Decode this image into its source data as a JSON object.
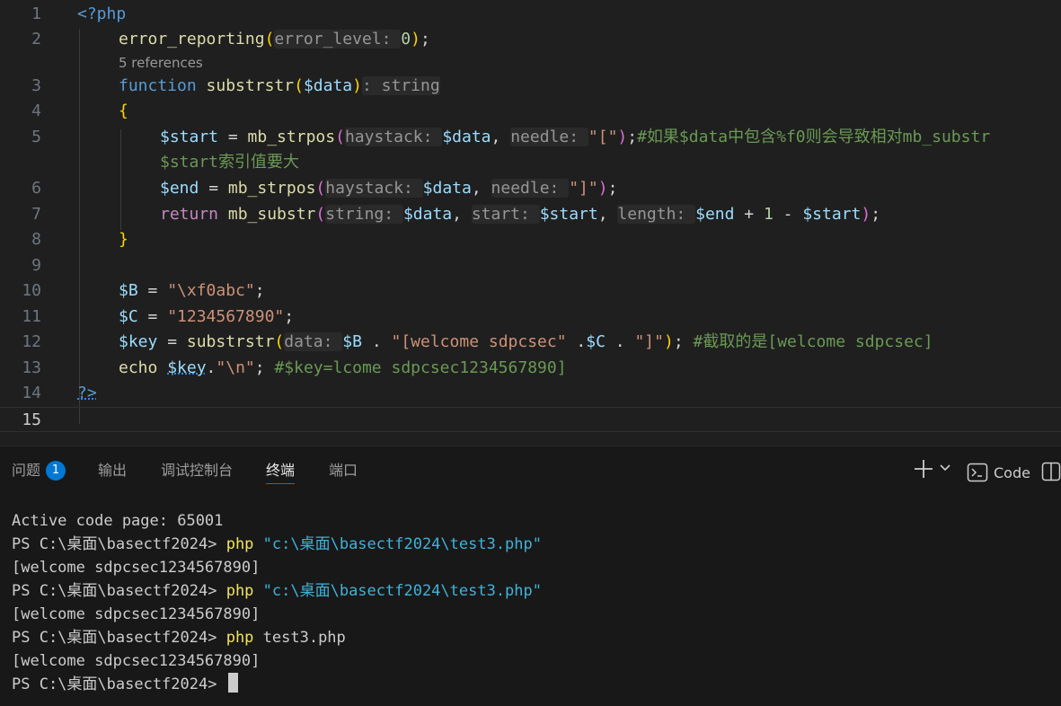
{
  "editor": {
    "code_lens": "5 references",
    "lines": [
      {
        "n": "1",
        "tokens": [
          [
            "t-kw",
            "<?php"
          ]
        ]
      },
      {
        "n": "2",
        "tokens": [
          [
            "t-fn",
            "error_reporting"
          ],
          [
            "t-b1",
            "("
          ],
          [
            "hint",
            "error_level: "
          ],
          [
            "t-num",
            "0"
          ],
          [
            "t-b1",
            ")"
          ],
          [
            "t-punc",
            ";"
          ]
        ]
      },
      {
        "n": "3",
        "tokens": [
          [
            "t-kw",
            "function "
          ],
          [
            "t-fn",
            "substrstr"
          ],
          [
            "t-b1",
            "("
          ],
          [
            "t-var",
            "$data"
          ],
          [
            "t-b1",
            ")"
          ],
          [
            "hint",
            ": string"
          ]
        ]
      },
      {
        "n": "4",
        "tokens": [
          [
            "t-b1",
            "{"
          ]
        ]
      },
      {
        "n": "5",
        "tokens": [
          [
            "t-var",
            "$start"
          ],
          [
            "t-punc",
            " = "
          ],
          [
            "t-fn",
            "mb_strpos"
          ],
          [
            "t-b2",
            "("
          ],
          [
            "hint",
            "haystack: "
          ],
          [
            "t-var",
            "$data"
          ],
          [
            "t-punc",
            ", "
          ],
          [
            "hint",
            "needle: "
          ],
          [
            "t-str",
            "\"[\""
          ],
          [
            "t-b2",
            ")"
          ],
          [
            "t-punc",
            ";"
          ],
          [
            "t-com",
            "#如果$data中包含%f0则会导致相对mb_substr"
          ]
        ]
      },
      {
        "n": "",
        "tokens": [
          [
            "t-com",
            "$start索引值要大"
          ]
        ]
      },
      {
        "n": "6",
        "tokens": [
          [
            "t-var",
            "$end"
          ],
          [
            "t-punc",
            " = "
          ],
          [
            "t-fn",
            "mb_strpos"
          ],
          [
            "t-b2",
            "("
          ],
          [
            "hint",
            "haystack: "
          ],
          [
            "t-var",
            "$data"
          ],
          [
            "t-punc",
            ", "
          ],
          [
            "hint",
            "needle: "
          ],
          [
            "t-str",
            "\"]\""
          ],
          [
            "t-b2",
            ")"
          ],
          [
            "t-punc",
            ";"
          ]
        ]
      },
      {
        "n": "7",
        "tokens": [
          [
            "t-ctl",
            "return "
          ],
          [
            "t-fn",
            "mb_substr"
          ],
          [
            "t-b2",
            "("
          ],
          [
            "hint",
            "string: "
          ],
          [
            "t-var",
            "$data"
          ],
          [
            "t-punc",
            ", "
          ],
          [
            "hint",
            "start: "
          ],
          [
            "t-var",
            "$start"
          ],
          [
            "t-punc",
            ", "
          ],
          [
            "hint",
            "length: "
          ],
          [
            "t-var",
            "$end"
          ],
          [
            "t-punc",
            " + "
          ],
          [
            "t-num",
            "1"
          ],
          [
            "t-punc",
            " - "
          ],
          [
            "t-var",
            "$start"
          ],
          [
            "t-b2",
            ")"
          ],
          [
            "t-punc",
            ";"
          ]
        ]
      },
      {
        "n": "8",
        "tokens": [
          [
            "t-b1",
            "}"
          ]
        ]
      },
      {
        "n": "9",
        "tokens": []
      },
      {
        "n": "10",
        "tokens": [
          [
            "t-var",
            "$B"
          ],
          [
            "t-punc",
            " = "
          ],
          [
            "t-str",
            "\"\\xf0abc\""
          ],
          [
            "t-punc",
            ";"
          ]
        ]
      },
      {
        "n": "11",
        "tokens": [
          [
            "t-var",
            "$C"
          ],
          [
            "t-punc",
            " = "
          ],
          [
            "t-str",
            "\"1234567890\""
          ],
          [
            "t-punc",
            ";"
          ]
        ]
      },
      {
        "n": "12",
        "tokens": [
          [
            "t-var",
            "$key"
          ],
          [
            "t-punc",
            " = "
          ],
          [
            "t-fn",
            "substrstr"
          ],
          [
            "t-b1",
            "("
          ],
          [
            "hint",
            "data: "
          ],
          [
            "t-var",
            "$B"
          ],
          [
            "t-punc",
            " . "
          ],
          [
            "t-str",
            "\"[welcome sdpcsec\""
          ],
          [
            "t-punc",
            " ."
          ],
          [
            "t-var",
            "$C"
          ],
          [
            "t-punc",
            " . "
          ],
          [
            "t-str",
            "\"]\""
          ],
          [
            "t-b1",
            ")"
          ],
          [
            "t-punc",
            "; "
          ],
          [
            "t-com",
            "#截取的是[welcome sdpcsec]"
          ]
        ]
      },
      {
        "n": "13",
        "tokens": [
          [
            "t-fn",
            "echo "
          ],
          [
            "t-var squig",
            "$key"
          ],
          [
            "t-punc",
            "."
          ],
          [
            "t-str",
            "\"\\n\""
          ],
          [
            "t-punc",
            "; "
          ],
          [
            "t-com",
            "#$key=lcome sdpcsec1234567890]"
          ]
        ]
      },
      {
        "n": "14",
        "tokens": [
          [
            "t-kw squig",
            "?>"
          ]
        ]
      },
      {
        "n": "15",
        "tokens": []
      }
    ]
  },
  "panel": {
    "tabs": [
      {
        "label": "问题",
        "badge": "1"
      },
      {
        "label": "输出"
      },
      {
        "label": "调试控制台"
      },
      {
        "label": "终端"
      },
      {
        "label": "端口"
      }
    ],
    "toolbar": {
      "new_terminal": "+",
      "dropdown": "⌄",
      "profile_label": "Code",
      "layout_icon": "split-icon"
    }
  },
  "terminal": {
    "lines": [
      [
        [
          "plain",
          "Active code page: 65001"
        ]
      ],
      [
        [
          "plain",
          "PS C:\\桌面\\basectf2024> "
        ],
        [
          "cmd-php",
          "php "
        ],
        [
          "cmd-str",
          "\"c:\\桌面\\basectf2024\\test3.php\""
        ]
      ],
      [
        [
          "plain",
          "[welcome sdpcsec1234567890]"
        ]
      ],
      [
        [
          "plain",
          "PS C:\\桌面\\basectf2024> "
        ],
        [
          "cmd-php",
          "php "
        ],
        [
          "cmd-str",
          "\"c:\\桌面\\basectf2024\\test3.php\""
        ]
      ],
      [
        [
          "plain",
          "[welcome sdpcsec1234567890]"
        ]
      ],
      [
        [
          "plain",
          "PS C:\\桌面\\basectf2024> "
        ],
        [
          "cmd-php",
          "php "
        ],
        [
          "plain",
          "test3.php"
        ]
      ],
      [
        [
          "plain",
          "[welcome sdpcsec1234567890]"
        ]
      ],
      [
        [
          "plain",
          "PS C:\\桌面\\basectf2024> "
        ]
      ]
    ]
  }
}
